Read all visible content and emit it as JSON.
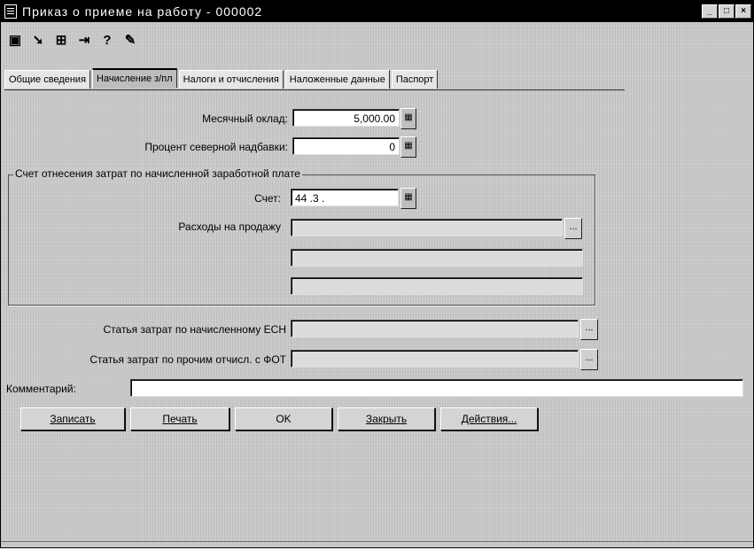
{
  "window": {
    "title": "Приказ о приеме на работу - 000002",
    "controls": [
      "_",
      "□",
      "×"
    ]
  },
  "toolbar": {
    "icons": [
      {
        "name": "save-doc-icon",
        "glyph": "▣"
      },
      {
        "name": "cursor-icon",
        "glyph": "➘"
      },
      {
        "name": "table-icon",
        "glyph": "⊞"
      },
      {
        "name": "move-icon",
        "glyph": "⇥"
      },
      {
        "name": "help-icon",
        "glyph": "?"
      },
      {
        "name": "properties-icon",
        "glyph": "✎"
      }
    ]
  },
  "tabs": [
    "Общие сведения",
    "Начисление з/пл",
    "Налоги и отчисления",
    "Наложенные данные",
    "Паспорт"
  ],
  "form": {
    "monthly_salary_label": "Месячный оклад:",
    "monthly_salary_value": "5,000.00",
    "northern_allowance_label": "Процент северной надбавки:",
    "northern_allowance_value": "0",
    "group_title": "Счет отнесения затрат по начисленной заработной плате",
    "account_label": "Счет:",
    "account_value": "44 .3 .",
    "expenses_label": "Расходы на продажу",
    "ech_label": "Статья затрат по начисленному ЕСН",
    "other_label": "Статья затрат по прочим отчисл. с ФОТ",
    "comment_label": "Комментарий:",
    "comment_value": "",
    "calc_glyph": "▦",
    "select_glyph": "..."
  },
  "buttons": {
    "save": "Записать",
    "print": "Печать",
    "ok": "OK",
    "close": "Закрыть",
    "actions": "Действия..."
  }
}
